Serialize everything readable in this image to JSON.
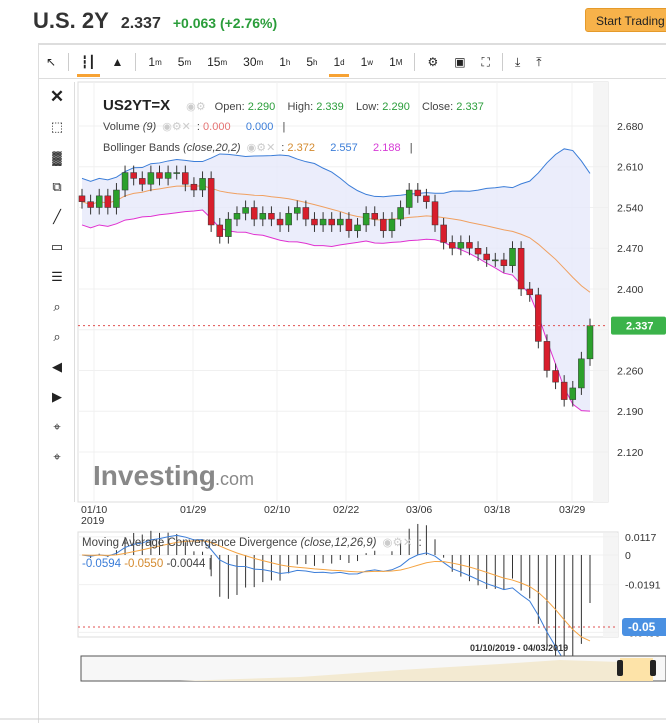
{
  "header": {
    "title": "U.S. 2Y",
    "last": "2.337",
    "change": "+0.063 (+2.76%)",
    "trade_button": "Start Trading"
  },
  "toolbar": {
    "intervals": [
      {
        "n": "1",
        "u": "m"
      },
      {
        "n": "5",
        "u": "m"
      },
      {
        "n": "15",
        "u": "m"
      },
      {
        "n": "30",
        "u": "m"
      },
      {
        "n": "1",
        "u": "h"
      },
      {
        "n": "5",
        "u": "h"
      },
      {
        "n": "1",
        "u": "d"
      },
      {
        "n": "1",
        "u": "w"
      },
      {
        "n": "1",
        "u": "M"
      }
    ],
    "active_interval": "1d"
  },
  "legend": {
    "symbol": "US2YT=X",
    "open_label": "Open:",
    "open": "2.290",
    "high_label": "High:",
    "high": "2.339",
    "low_label": "Low:",
    "low": "2.290",
    "close_label": "Close:",
    "close": "2.337",
    "volume_label": "Volume",
    "volume_param": "(9)",
    "volume_v1": "0.000",
    "volume_v2": "0.000",
    "bb_label": "Bollinger Bands",
    "bb_param": "(close,20,2)",
    "bb_mid": "2.372",
    "bb_upper": "2.557",
    "bb_lower": "2.188"
  },
  "macd": {
    "label": "Moving Average Convergence Divergence",
    "param": "(close,12,26,9)",
    "macd": "-0.0594",
    "signal": "-0.0550",
    "hist": "-0.0044",
    "ticks": [
      "0.0117",
      "0",
      "-0.0191",
      "-0.0499"
    ],
    "current": "-0.05"
  },
  "navigator": {
    "range": "01/10/2019 - 04/03/2019"
  },
  "watermark": "Investing.com",
  "colors": {
    "up": "#2ca02c",
    "down": "#d81e2c",
    "bb_upper": "#3b7dd8",
    "bb_mid": "#f0a060",
    "bb_lower": "#e030d0",
    "macd": "#3b7dd8",
    "signal": "#f5a442"
  },
  "chart_data": {
    "type": "candlestick",
    "title": "US2YT=X",
    "ylim": [
      2.1,
      2.7
    ],
    "yticks": [
      "2.680",
      "2.610",
      "2.540",
      "2.470",
      "2.400",
      "2.330",
      "2.260",
      "2.190",
      "2.120"
    ],
    "xticks": [
      "01/10",
      "01/29",
      "02/10",
      "02/22",
      "03/06",
      "03/18",
      "03/29"
    ],
    "xtick_sub": "2019",
    "current_price": "2.337",
    "closes": [
      2.55,
      2.54,
      2.56,
      2.54,
      2.57,
      2.6,
      2.59,
      2.58,
      2.6,
      2.59,
      2.6,
      2.6,
      2.58,
      2.57,
      2.59,
      2.51,
      2.49,
      2.52,
      2.53,
      2.54,
      2.52,
      2.53,
      2.52,
      2.51,
      2.53,
      2.54,
      2.52,
      2.51,
      2.52,
      2.51,
      2.52,
      2.5,
      2.51,
      2.53,
      2.52,
      2.5,
      2.52,
      2.54,
      2.57,
      2.56,
      2.55,
      2.51,
      2.48,
      2.47,
      2.48,
      2.47,
      2.46,
      2.45,
      2.45,
      2.44,
      2.47,
      2.4,
      2.39,
      2.31,
      2.26,
      2.24,
      2.21,
      2.23,
      2.28,
      2.337
    ],
    "first_open": 2.56
  }
}
